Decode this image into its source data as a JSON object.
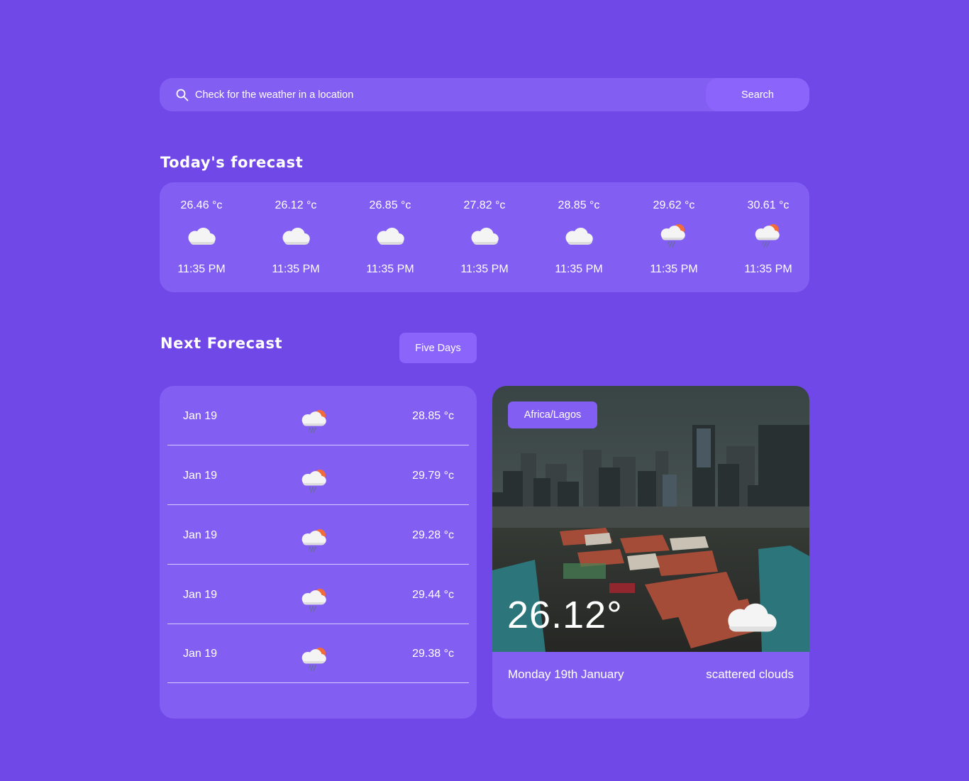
{
  "search": {
    "placeholder": "Check for the weather in a location",
    "button_label": "Search",
    "icon": "search-icon"
  },
  "today": {
    "title": "Today's forecast",
    "items": [
      {
        "temp": "26.46 °c",
        "time": "11:35 PM",
        "icon": "cloud-icon"
      },
      {
        "temp": "26.12 °c",
        "time": "11:35 PM",
        "icon": "cloud-icon"
      },
      {
        "temp": "26.85 °c",
        "time": "11:35 PM",
        "icon": "cloud-icon"
      },
      {
        "temp": "27.82 °c",
        "time": "11:35 PM",
        "icon": "cloud-icon"
      },
      {
        "temp": "28.85 °c",
        "time": "11:35 PM",
        "icon": "cloud-icon"
      },
      {
        "temp": "29.62 °c",
        "time": "11:35 PM",
        "icon": "sun-rain-cloud-icon"
      },
      {
        "temp": "30.61 °c",
        "time": "11:35 PM",
        "icon": "sun-rain-cloud-icon"
      }
    ]
  },
  "next": {
    "title": "Next Forecast",
    "range_button_label": "Five Days",
    "days": [
      {
        "date": "Jan 19",
        "temp": "28.85 °c",
        "icon": "sun-rain-cloud-icon"
      },
      {
        "date": "Jan 19",
        "temp": "29.79 °c",
        "icon": "sun-rain-cloud-icon"
      },
      {
        "date": "Jan 19",
        "temp": "29.28 °c",
        "icon": "sun-rain-cloud-icon"
      },
      {
        "date": "Jan 19",
        "temp": "29.44 °c",
        "icon": "sun-rain-cloud-icon"
      },
      {
        "date": "Jan 19",
        "temp": "29.38 °c",
        "icon": "sun-rain-cloud-icon"
      }
    ]
  },
  "current": {
    "location": "Africa/Lagos",
    "temperature": "26.12°",
    "date": "Monday 19th January",
    "description": "scattered clouds",
    "icon": "cloud-icon"
  },
  "colors": {
    "background": "#7048e8",
    "card": "#825ff2",
    "button": "#8b65fb",
    "divider": "#d8ccff",
    "sun": "#f26b3a"
  }
}
